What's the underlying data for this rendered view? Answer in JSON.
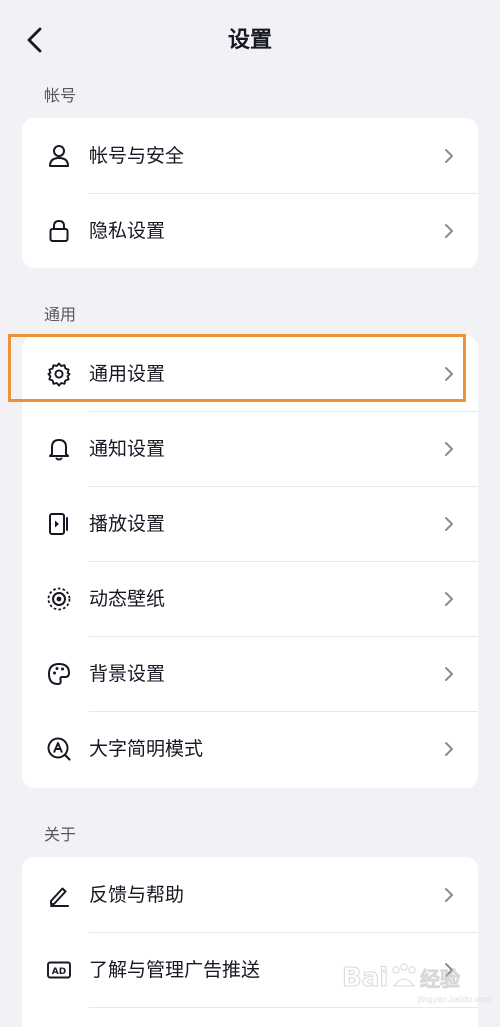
{
  "header": {
    "title": "设置"
  },
  "sections": [
    {
      "label": "帐号",
      "items": [
        {
          "label": "帐号与安全",
          "icon": "user-icon"
        },
        {
          "label": "隐私设置",
          "icon": "lock-icon"
        }
      ]
    },
    {
      "label": "通用",
      "items": [
        {
          "label": "通用设置",
          "icon": "gear-icon"
        },
        {
          "label": "通知设置",
          "icon": "bell-icon"
        },
        {
          "label": "播放设置",
          "icon": "play-settings-icon"
        },
        {
          "label": "动态壁纸",
          "icon": "live-wallpaper-icon"
        },
        {
          "label": "背景设置",
          "icon": "palette-icon"
        },
        {
          "label": "大字简明模式",
          "icon": "large-text-icon"
        }
      ]
    },
    {
      "label": "关于",
      "items": [
        {
          "label": "反馈与帮助",
          "icon": "pencil-icon"
        },
        {
          "label": "了解与管理广告推送",
          "icon": "ad-icon"
        }
      ]
    }
  ],
  "highlight_color": "#f0913a",
  "watermark": {
    "text": "Baidu经验"
  }
}
